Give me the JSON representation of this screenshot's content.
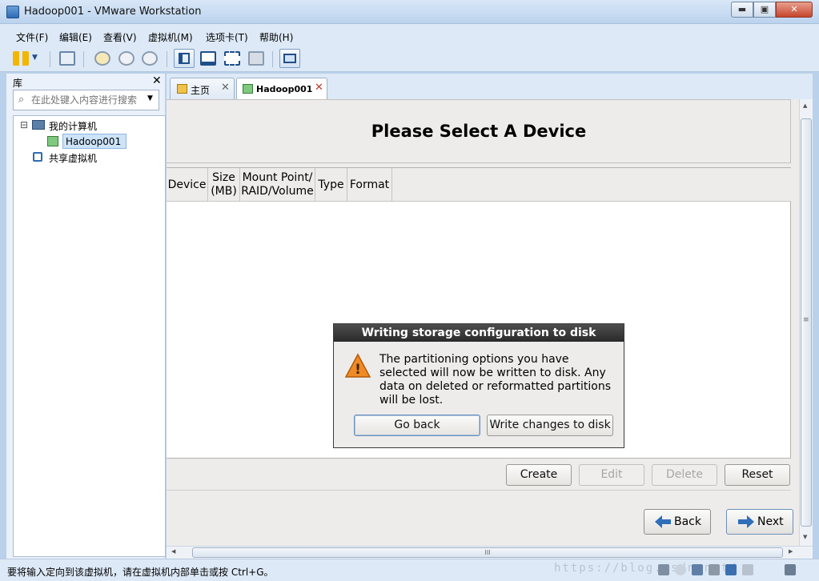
{
  "window": {
    "title": "Hadoop001 - VMware Workstation",
    "min": "▬",
    "max": "▣",
    "close": "✕"
  },
  "menubar": {
    "items": [
      "文件(F)",
      "编辑(E)",
      "查看(V)",
      "虚拟机(M)",
      "选项卡(T)",
      "帮助(H)"
    ]
  },
  "toolbar": {
    "icons": [
      "pause-icon",
      "dropdown-icon",
      "send-ctrl-alt-del-icon",
      "snapshot-icon",
      "revert-snapshot-icon",
      "snapshot-manager-icon",
      "show-library-icon",
      "thumbnail-bar-icon",
      "fullscreen-icon",
      "unity-icon",
      "console-view-icon"
    ],
    "dropdown_glyph": "▼"
  },
  "library": {
    "title": "库",
    "close": "✕",
    "search": {
      "placeholder": "在此处键入内容进行搜索",
      "icon": "⌕",
      "dropdown": "▼"
    },
    "tree": {
      "collapse_glyph": "⊟",
      "root": "我的计算机",
      "vm": "Hadoop001",
      "shared": "共享虚拟机"
    }
  },
  "tabs": [
    {
      "label": "主页",
      "icon": "home-icon",
      "close": "✕"
    },
    {
      "label": "Hadoop001",
      "icon": "vm-icon",
      "close": "✕"
    }
  ],
  "installer": {
    "title": "Please Select A Device",
    "columns": [
      "Device",
      "Size\n(MB)",
      "Mount Point/\nRAID/Volume",
      "Type",
      "Format"
    ],
    "buttons": {
      "create": "Create",
      "edit": "Edit",
      "delete": "Delete",
      "reset": "Reset"
    },
    "nav": {
      "back": "Back",
      "next": "Next"
    }
  },
  "dialog": {
    "title": "Writing storage configuration to disk",
    "message": "The partitioning options you have selected will now be written to disk.  Any data on deleted or reformatted partitions will be lost.",
    "go_back": "Go back",
    "write": "Write changes to disk",
    "warning_glyph": "!"
  },
  "scroll": {
    "up": "▲",
    "down": "▼",
    "left": "◀",
    "right": "▶",
    "grip_v": "≡",
    "grip_h": "III"
  },
  "status": {
    "text": "要将输入定向到该虚拟机，请在虚拟机内部单击或按 Ctrl+G。",
    "watermark": "https://blog.csdn.net/"
  },
  "colors": {
    "frame": "#dde9f6",
    "accent": "#2d6bb5",
    "guest_bg": "#edeceb",
    "dialog_title": "#2a2a2a"
  }
}
